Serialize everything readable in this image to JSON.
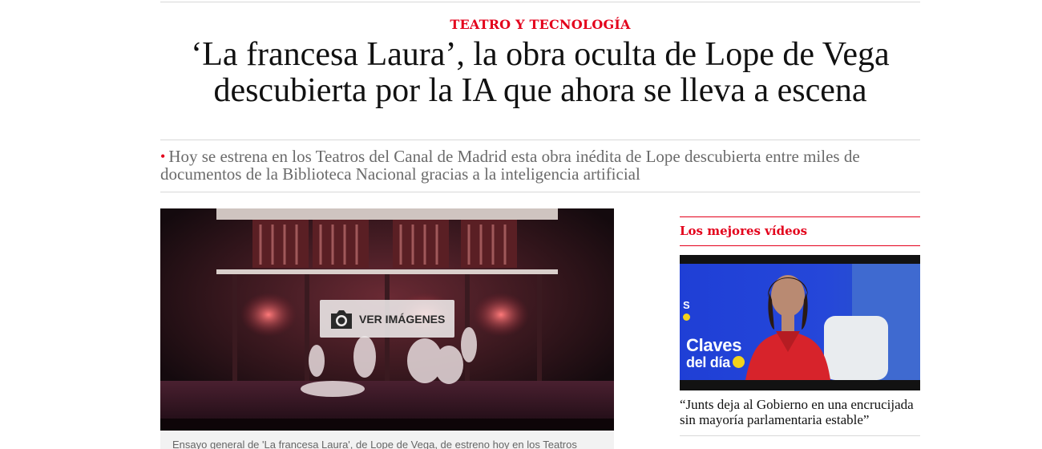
{
  "article": {
    "section_tag": "TEATRO Y TECNOLOGÍA",
    "headline_line1": "‘La francesa Laura’, la obra oculta de Lope de Vega",
    "headline_line2": "descubierta por la IA que ahora se lleva a escena",
    "lead_bullet": "•",
    "lead": "Hoy se estrena en los Teatros del Canal de Madrid esta obra inédita de Lope descubierta entre miles de documentos de la Biblioteca Nacional gracias a la inteligencia artificial",
    "gallery_button": "VER IMÁGENES",
    "gallery_icon": "camera-icon",
    "caption": "Ensayo general de 'La francesa Laura', de Lope de Vega, de estreno hoy en los Teatros"
  },
  "sidebar": {
    "title": "Los mejores vídeos",
    "video": {
      "overlay_s": "S",
      "overlay_title_1": "Claves",
      "overlay_title_2": "del día",
      "headline": "“Junts deja al Gobierno en una encrucijada sin mayoría parlamentaria estable”"
    }
  },
  "colors": {
    "accent": "#e3001b",
    "lead_text": "#6b6b6b",
    "rule": "#d8d8d8"
  }
}
